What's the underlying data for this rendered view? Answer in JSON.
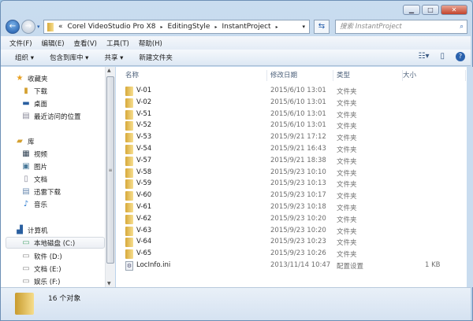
{
  "window": {
    "min": "▁",
    "max": "□",
    "close": "✕"
  },
  "address": {
    "overflow": "«",
    "parts": [
      "Corel VideoStudio Pro X8",
      "EditingStyle",
      "InstantProject"
    ],
    "sep": "▸",
    "dropdown": "▾"
  },
  "search": {
    "placeholder": "搜索 InstantProject"
  },
  "menu": [
    "文件(F)",
    "编辑(E)",
    "查看(V)",
    "工具(T)",
    "帮助(H)"
  ],
  "toolbar": [
    "组织 ▾",
    "包含到库中 ▾",
    "共享 ▾",
    "新建文件夹"
  ],
  "nav": {
    "favorites": {
      "label": "收藏夹",
      "items": [
        "下载",
        "桌面",
        "最近访问的位置"
      ]
    },
    "libraries": {
      "label": "库",
      "items": [
        "视频",
        "图片",
        "文档",
        "迅雷下载",
        "音乐"
      ]
    },
    "computer": {
      "label": "计算机",
      "items": [
        "本地磁盘 (C:)",
        "软件 (D:)",
        "文档 (E:)",
        "娱乐 (F:)"
      ]
    }
  },
  "columns": [
    "名称",
    "修改日期",
    "类型",
    "大小"
  ],
  "files": [
    {
      "name": "V-01",
      "date": "2015/6/10 13:01",
      "type": "文件夹",
      "size": ""
    },
    {
      "name": "V-02",
      "date": "2015/6/10 13:01",
      "type": "文件夹",
      "size": ""
    },
    {
      "name": "V-51",
      "date": "2015/6/10 13:01",
      "type": "文件夹",
      "size": ""
    },
    {
      "name": "V-52",
      "date": "2015/6/10 13:01",
      "type": "文件夹",
      "size": ""
    },
    {
      "name": "V-53",
      "date": "2015/9/21 17:12",
      "type": "文件夹",
      "size": ""
    },
    {
      "name": "V-54",
      "date": "2015/9/21 16:43",
      "type": "文件夹",
      "size": ""
    },
    {
      "name": "V-57",
      "date": "2015/9/21 18:38",
      "type": "文件夹",
      "size": ""
    },
    {
      "name": "V-58",
      "date": "2015/9/23 10:10",
      "type": "文件夹",
      "size": ""
    },
    {
      "name": "V-59",
      "date": "2015/9/23 10:13",
      "type": "文件夹",
      "size": ""
    },
    {
      "name": "V-60",
      "date": "2015/9/23 10:17",
      "type": "文件夹",
      "size": ""
    },
    {
      "name": "V-61",
      "date": "2015/9/23 10:18",
      "type": "文件夹",
      "size": ""
    },
    {
      "name": "V-62",
      "date": "2015/9/23 10:20",
      "type": "文件夹",
      "size": ""
    },
    {
      "name": "V-63",
      "date": "2015/9/23 10:20",
      "type": "文件夹",
      "size": ""
    },
    {
      "name": "V-64",
      "date": "2015/9/23 10:23",
      "type": "文件夹",
      "size": ""
    },
    {
      "name": "V-65",
      "date": "2015/9/23 10:26",
      "type": "文件夹",
      "size": ""
    },
    {
      "name": "LocInfo.ini",
      "date": "2013/11/14 10:47",
      "type": "配置设置",
      "size": "1 KB"
    }
  ],
  "status": {
    "count": "16 个对象"
  }
}
